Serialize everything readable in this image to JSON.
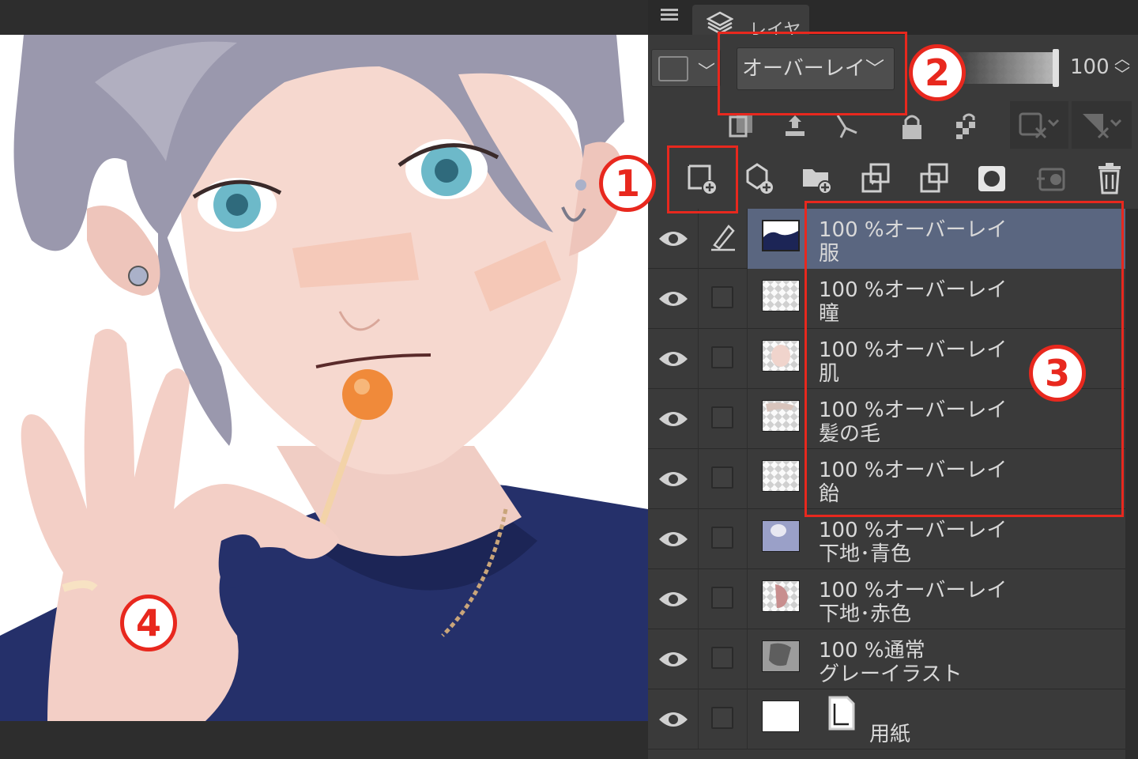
{
  "panel": {
    "tab_label": "レイヤー",
    "blend_mode": "オーバーレイ",
    "opacity": "100"
  },
  "layers": [
    {
      "mode": "100 %オーバーレイ",
      "name": "服",
      "selected": true
    },
    {
      "mode": "100 %オーバーレイ",
      "name": "瞳"
    },
    {
      "mode": "100 %オーバーレイ",
      "name": "肌"
    },
    {
      "mode": "100 %オーバーレイ",
      "name": "髪の毛"
    },
    {
      "mode": "100 %オーバーレイ",
      "name": "飴"
    },
    {
      "mode": "100 %オーバーレイ",
      "name": "下地･青色"
    },
    {
      "mode": "100 %オーバーレイ",
      "name": "下地･赤色"
    },
    {
      "mode": "100 %通常",
      "name": "グレーイラスト"
    },
    {
      "mode": "",
      "name": "用紙"
    }
  ],
  "annotations": {
    "n1": "1",
    "n2": "2",
    "n3": "3",
    "n4": "4"
  },
  "colors": {
    "annotation_red": "#e8281e",
    "selected_row": "#5a6680",
    "panel_bg": "#3a3a3a"
  }
}
